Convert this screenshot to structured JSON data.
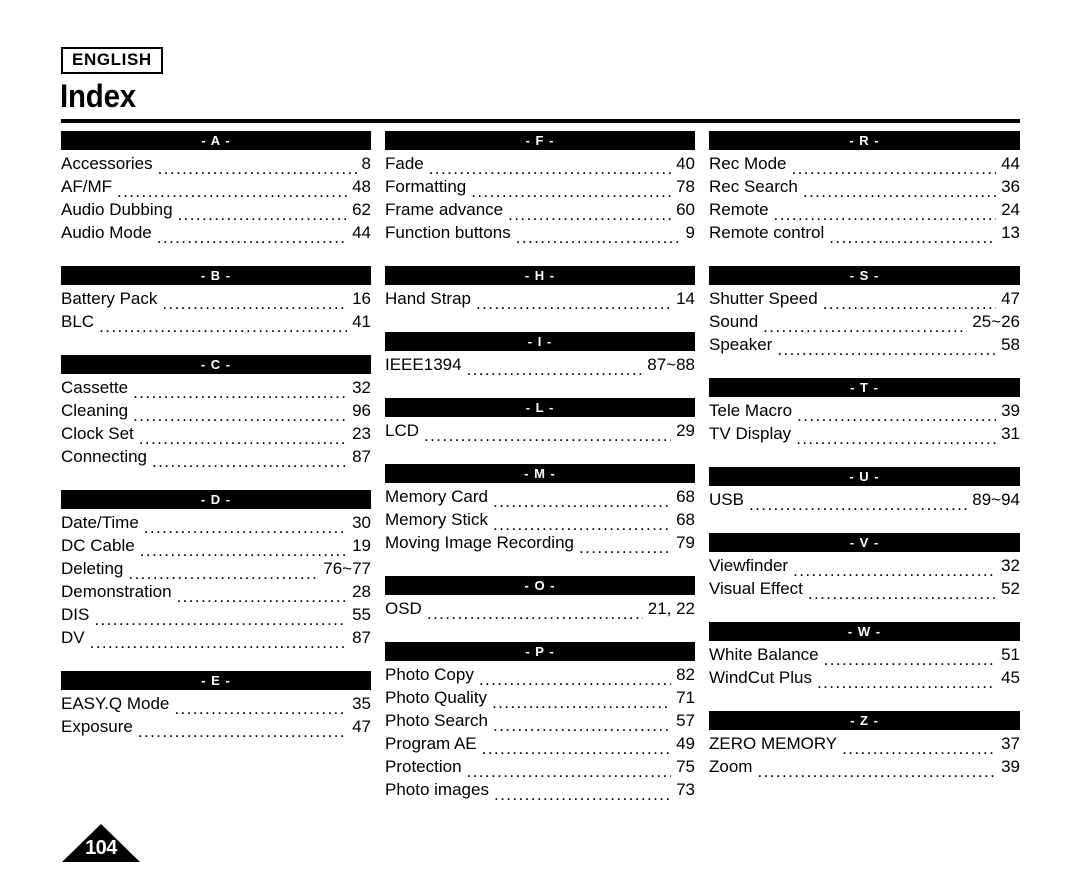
{
  "header": {
    "language_badge": "ENGLISH",
    "title": "Index"
  },
  "footer": {
    "page_number": "104"
  },
  "columns": [
    {
      "id": "column-1",
      "sections": [
        {
          "letter": "- A -",
          "entries": [
            {
              "label": "Accessories",
              "page": "8"
            },
            {
              "label": "AF/MF",
              "page": "48"
            },
            {
              "label": "Audio Dubbing",
              "page": "62"
            },
            {
              "label": "Audio Mode",
              "page": "44"
            }
          ]
        },
        {
          "letter": "- B -",
          "entries": [
            {
              "label": "Battery Pack",
              "page": "16"
            },
            {
              "label": "BLC",
              "page": "41"
            }
          ]
        },
        {
          "letter": "- C -",
          "entries": [
            {
              "label": "Cassette",
              "page": "32"
            },
            {
              "label": "Cleaning",
              "page": "96"
            },
            {
              "label": "Clock Set",
              "page": "23"
            },
            {
              "label": "Connecting",
              "page": "87"
            }
          ]
        },
        {
          "letter": "- D -",
          "entries": [
            {
              "label": "Date/Time",
              "page": "30"
            },
            {
              "label": "DC Cable",
              "page": "19"
            },
            {
              "label": "Deleting",
              "page": "76~77"
            },
            {
              "label": "Demonstration",
              "page": "28"
            },
            {
              "label": "DIS",
              "page": "55"
            },
            {
              "label": "DV",
              "page": "87"
            }
          ]
        },
        {
          "letter": "- E -",
          "entries": [
            {
              "label": "EASY.Q Mode",
              "page": "35"
            },
            {
              "label": "Exposure",
              "page": "47"
            }
          ]
        }
      ]
    },
    {
      "id": "column-2",
      "sections": [
        {
          "letter": "- F -",
          "entries": [
            {
              "label": "Fade",
              "page": "40"
            },
            {
              "label": "Formatting",
              "page": "78"
            },
            {
              "label": "Frame advance",
              "page": "60"
            },
            {
              "label": "Function buttons",
              "page": "9"
            }
          ]
        },
        {
          "letter": "- H -",
          "entries": [
            {
              "label": "Hand Strap",
              "page": "14"
            }
          ]
        },
        {
          "letter": "- I -",
          "entries": [
            {
              "label": "IEEE1394",
              "page": "87~88"
            }
          ]
        },
        {
          "letter": "- L -",
          "entries": [
            {
              "label": "LCD",
              "page": "29"
            }
          ]
        },
        {
          "letter": "- M -",
          "entries": [
            {
              "label": "Memory Card",
              "page": "68"
            },
            {
              "label": "Memory Stick",
              "page": "68"
            },
            {
              "label": "Moving Image Recording",
              "page": "79"
            }
          ]
        },
        {
          "letter": "- O -",
          "entries": [
            {
              "label": "OSD",
              "page": "21, 22"
            }
          ]
        },
        {
          "letter": "- P -",
          "entries": [
            {
              "label": "Photo Copy",
              "page": "82"
            },
            {
              "label": "Photo Quality",
              "page": "71"
            },
            {
              "label": "Photo Search",
              "page": "57"
            },
            {
              "label": "Program AE",
              "page": "49"
            },
            {
              "label": "Protection",
              "page": "75"
            },
            {
              "label": "Photo images",
              "page": "73"
            }
          ]
        }
      ]
    },
    {
      "id": "column-3",
      "sections": [
        {
          "letter": "- R -",
          "entries": [
            {
              "label": "Rec Mode",
              "page": "44"
            },
            {
              "label": "Rec Search",
              "page": "36"
            },
            {
              "label": "Remote",
              "page": "24"
            },
            {
              "label": "Remote control",
              "page": "13"
            }
          ]
        },
        {
          "letter": "- S -",
          "entries": [
            {
              "label": "Shutter Speed",
              "page": "47"
            },
            {
              "label": "Sound",
              "page": "25~26"
            },
            {
              "label": "Speaker",
              "page": "58"
            }
          ]
        },
        {
          "letter": "- T -",
          "entries": [
            {
              "label": "Tele Macro",
              "page": "39"
            },
            {
              "label": "TV Display",
              "page": "31"
            }
          ]
        },
        {
          "letter": "- U -",
          "entries": [
            {
              "label": "USB",
              "page": "89~94"
            }
          ]
        },
        {
          "letter": "- V -",
          "entries": [
            {
              "label": "Viewfinder",
              "page": "32"
            },
            {
              "label": "Visual Effect",
              "page": "52"
            }
          ]
        },
        {
          "letter": "- W -",
          "entries": [
            {
              "label": "White Balance",
              "page": "51"
            },
            {
              "label": "WindCut Plus",
              "page": "45"
            }
          ]
        },
        {
          "letter": "- Z -",
          "entries": [
            {
              "label": "ZERO MEMORY",
              "page": "37"
            },
            {
              "label": "Zoom",
              "page": "39"
            }
          ]
        }
      ]
    }
  ]
}
